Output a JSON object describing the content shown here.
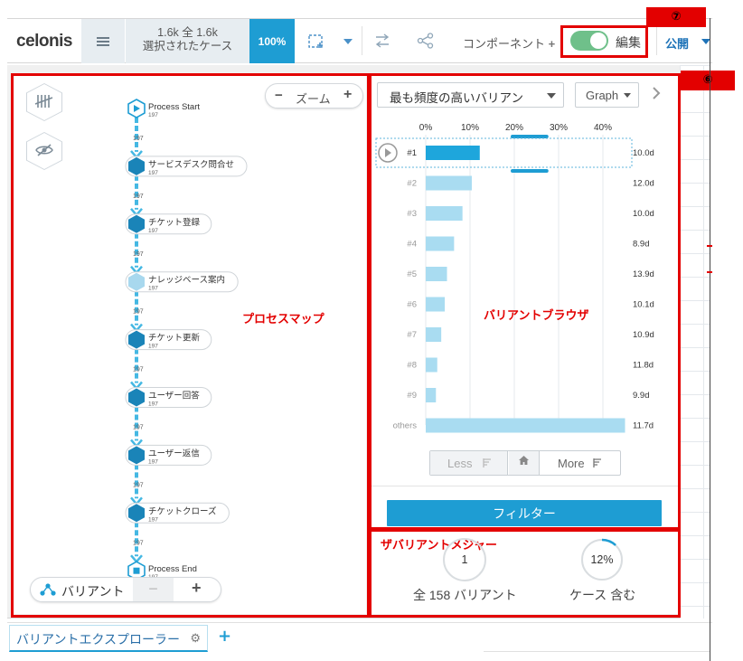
{
  "toolbar": {
    "logo_text": "celonis",
    "case_counts": "1.6k 全 1.6k",
    "case_caption": "選択されたケース",
    "case_percent": "100%",
    "component_label": "コンポーネント",
    "component_plus": "+",
    "edit_label": "編集",
    "publish_label": "公開"
  },
  "annotations": {
    "marker_7": "⑦",
    "marker_6": "⑥",
    "process_map_label": "プロセスマップ",
    "variant_browser_label": "バリアントブラウザ",
    "variant_measure_label": "ザバリアントメジャー"
  },
  "process_map": {
    "zoom_label": "ズーム",
    "zoom_minus": "−",
    "zoom_plus": "+",
    "variant_label": "バリアント",
    "variant_minus": "−",
    "variant_plus": "+",
    "nodes": [
      {
        "label": "Process Start",
        "count": "197",
        "kind": "start"
      },
      {
        "label": "サービスデスク問合せ",
        "count": "197",
        "kind": "activity"
      },
      {
        "label": "チケット登録",
        "count": "197",
        "kind": "activity"
      },
      {
        "label": "ナレッジベース案内",
        "count": "197",
        "kind": "activity-light"
      },
      {
        "label": "チケット更新",
        "count": "197",
        "kind": "activity"
      },
      {
        "label": "ユーザー回答",
        "count": "197",
        "kind": "activity"
      },
      {
        "label": "ユーザー返信",
        "count": "197",
        "kind": "activity"
      },
      {
        "label": "チケットクローズ",
        "count": "197",
        "kind": "activity"
      },
      {
        "label": "Process End",
        "count": "197",
        "kind": "end"
      }
    ],
    "edge_labels": [
      "197",
      "197",
      "197",
      "197",
      "197",
      "197",
      "197",
      "197"
    ]
  },
  "variant_browser": {
    "sort_select": "最も頻度の高いバリアン",
    "graph_label": "Graph",
    "less_label": "Less",
    "more_label": "More",
    "filter_label": "フィルター"
  },
  "chart_data": {
    "type": "bar",
    "orientation": "horizontal",
    "x_ticks": [
      "0%",
      "10%",
      "20%",
      "30%",
      "40%"
    ],
    "xlim": [
      0,
      45
    ],
    "categories": [
      "#1",
      "#2",
      "#3",
      "#4",
      "#5",
      "#6",
      "#7",
      "#8",
      "#9",
      "others"
    ],
    "values": [
      12.2,
      10.4,
      8.3,
      6.4,
      4.8,
      4.3,
      3.5,
      2.6,
      2.3,
      45
    ],
    "durations": [
      "10.0d",
      "12.0d",
      "10.0d",
      "8.9d",
      "13.9d",
      "10.1d",
      "10.9d",
      "11.8d",
      "9.9d",
      "11.7d"
    ],
    "selected": "#1",
    "colors": {
      "selected": "#1ea6dc",
      "bar": "#a9dcf1"
    }
  },
  "variant_measure": {
    "count_value": "1",
    "count_caption": "全 158 バリアント",
    "percent_value": "12%",
    "percent_caption": "ケース 含む"
  },
  "tabs": {
    "active_label": "バリアントエクスプローラー",
    "add_label": "+"
  }
}
